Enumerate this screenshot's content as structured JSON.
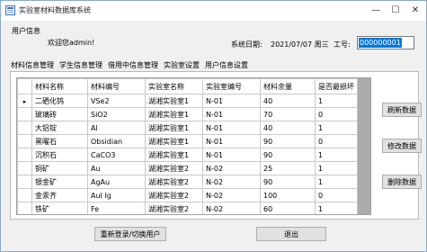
{
  "window": {
    "title": "实验室材料数据库系统",
    "controls": {
      "minimize": "—",
      "maximize": "☐",
      "close": "✕"
    }
  },
  "user_info": {
    "group_label": "用户信息",
    "welcome": "欢迎您admin!",
    "date_label": "系统日期:",
    "date_value": "2021/07/07 周三",
    "id_label": "工号:",
    "id_value": "000000001"
  },
  "tabs": [
    "材料信息管理",
    "学生信息管理",
    "借用中信息管理",
    "实验室设置",
    "用户信息设置"
  ],
  "table": {
    "columns": [
      "材料名称",
      "材料编号",
      "实验室名称",
      "实验室编号",
      "材料余量",
      "是否最损坏"
    ],
    "current_row_marker": "▸",
    "rows": [
      [
        "二硒化钨",
        "VSe2",
        "湖湘实验室1",
        "N-01",
        "40",
        "1"
      ],
      [
        "玻璃砖",
        "SiO2",
        "湖湘实验室1",
        "N-01",
        "70",
        "0"
      ],
      [
        "大铝锭",
        "Al",
        "湖湘实验室1",
        "N-01",
        "40",
        "1"
      ],
      [
        "黑曜石",
        "Obsidian",
        "湖湘实验室1",
        "N-01",
        "90",
        "0"
      ],
      [
        "沉积石",
        "CaCO3",
        "湖湘实验室1",
        "N-01",
        "90",
        "1"
      ],
      [
        "铜矿",
        "Au",
        "湖湘实验室2",
        "N-02",
        "25",
        "1"
      ],
      [
        "银金矿",
        "AgAu",
        "湖湘实验室2",
        "N-02",
        "90",
        "1"
      ],
      [
        "金汞齐",
        "AuI Ig",
        "湖湘实验室2",
        "N-02",
        "100",
        "0"
      ],
      [
        "铁矿",
        "Fe",
        "湖湘实验室2",
        "N-02",
        "60",
        "1"
      ]
    ]
  },
  "buttons": {
    "refresh": "刷新数据",
    "modify": "修改数据",
    "delete": "删除数据",
    "relogin": "重新登录/切换用户",
    "exit": "退出"
  }
}
